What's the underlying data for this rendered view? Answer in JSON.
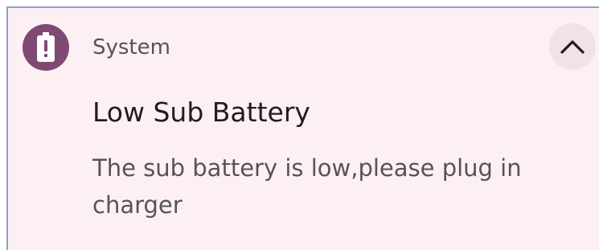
{
  "notification": {
    "app_name": "System",
    "app_icon": "battery-alert-icon",
    "title": "Low Sub Battery",
    "message": "The sub battery is low,please plug in charger",
    "expand_icon": "chevron-up-icon"
  },
  "colors": {
    "background": "#fdf0f3",
    "icon_bg": "#7e4a72",
    "expand_bg": "#f2e2e6",
    "title": "#1e1e1e",
    "secondary_text": "#555555"
  }
}
